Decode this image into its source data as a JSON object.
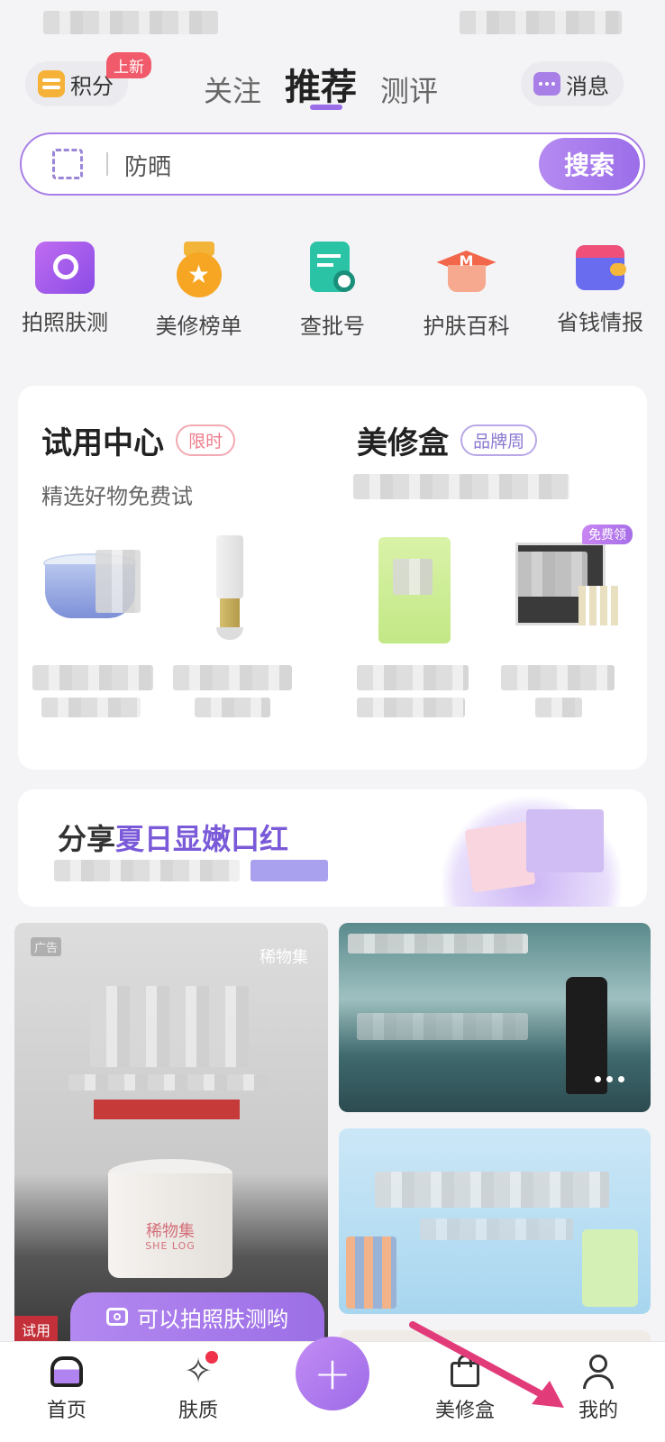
{
  "header": {
    "points_label": "积分",
    "points_badge": "上新",
    "tabs": [
      "关注",
      "推荐",
      "测评"
    ],
    "active_tab": "推荐",
    "messages_label": "消息"
  },
  "search": {
    "value": "防晒",
    "button_label": "搜索"
  },
  "shortcuts": [
    {
      "label": "拍照肤测",
      "icon": "camera-icon"
    },
    {
      "label": "美修榜单",
      "icon": "medal-icon"
    },
    {
      "label": "查批号",
      "icon": "doc-search-icon"
    },
    {
      "label": "护肤百科",
      "icon": "graduation-cap-icon"
    },
    {
      "label": "省钱情报",
      "icon": "wallet-icon"
    }
  ],
  "trial_center": {
    "title": "试用中心",
    "tag": "限时",
    "subtitle": "精选好物免费试"
  },
  "beauty_box": {
    "title": "美修盒",
    "tag": "品牌周",
    "free_badge": "免费领"
  },
  "share_banner": {
    "prefix": "分享",
    "highlight": "夏日显嫩口红"
  },
  "feed": {
    "ad_label": "广告",
    "brand_label": "稀物集",
    "product_brand": "稀物集",
    "product_brand_en": "SHE LOG",
    "trial_label": "试用",
    "skin_test_label": "可以拍照肤测哟"
  },
  "bottom_nav": [
    {
      "label": "首页",
      "icon": "home-icon"
    },
    {
      "label": "肤质",
      "icon": "sparkle-icon"
    },
    {
      "label": "",
      "icon": "plus-icon"
    },
    {
      "label": "美修盒",
      "icon": "bag-icon"
    },
    {
      "label": "我的",
      "icon": "user-icon"
    }
  ],
  "colors": {
    "accent": "#9b6ee9",
    "badge_red": "#f05a6a",
    "background": "#f4f4f6"
  }
}
